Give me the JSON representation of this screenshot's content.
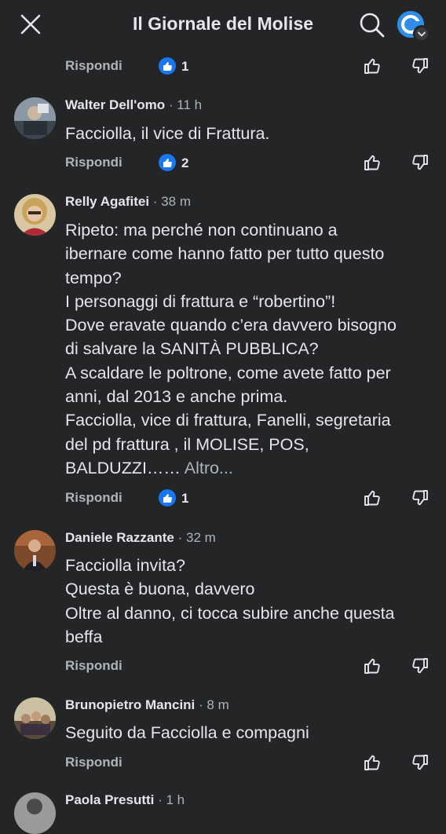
{
  "header": {
    "title": "Il Giornale del Molise"
  },
  "comments": [
    {
      "reply_label": "Rispondi",
      "likes": "1"
    },
    {
      "author": "Walter Dell'omo",
      "time": " · 11 h",
      "text": "Facciolla, il vice di Frattura.",
      "reply_label": "Rispondi",
      "likes": "2"
    },
    {
      "author": "Relly Agafitei",
      "time": " · 38 m",
      "text": "Ripeto: ma perché non continuano a\nibernare come hanno fatto per tutto questo\ntempo?\nI personaggi di frattura e “robertino”!\nDove eravate quando c’era davvero bisogno\ndi salvare la SANITÀ PUBBLICA?\nA scaldare le poltrone, come avete fatto per\nanni, dal 2013 e anche prima.\nFacciolla, vice di frattura, Fanelli, segretaria\ndel pd frattura , il MOLISE, POS,\nBALDUZZI……",
      "more": " Altro...",
      "reply_label": "Rispondi",
      "likes": "1"
    },
    {
      "author": "Daniele Razzante",
      "time": " · 32 m",
      "text": "Facciolla invita?\nQuesta è buona, davvero\nOltre al danno, ci tocca subire anche questa\nbeffa",
      "reply_label": "Rispondi"
    },
    {
      "author": "Brunopietro Mancini",
      "time": " · 8 m",
      "text": "Seguito da Facciolla e compagni",
      "reply_label": "Rispondi"
    },
    {
      "author": "Paola Presutti",
      "time": " · 1 h"
    }
  ],
  "icons": {
    "close": "close-icon",
    "search": "search-icon",
    "thumbs_up": "thumbs-up-icon",
    "thumbs_down": "thumbs-down-icon",
    "like_badge": "like-badge-icon"
  },
  "colors": {
    "background": "#242526",
    "text": "#e4e6eb",
    "secondary": "#b0b3b8",
    "like_blue": "#1877f2"
  }
}
